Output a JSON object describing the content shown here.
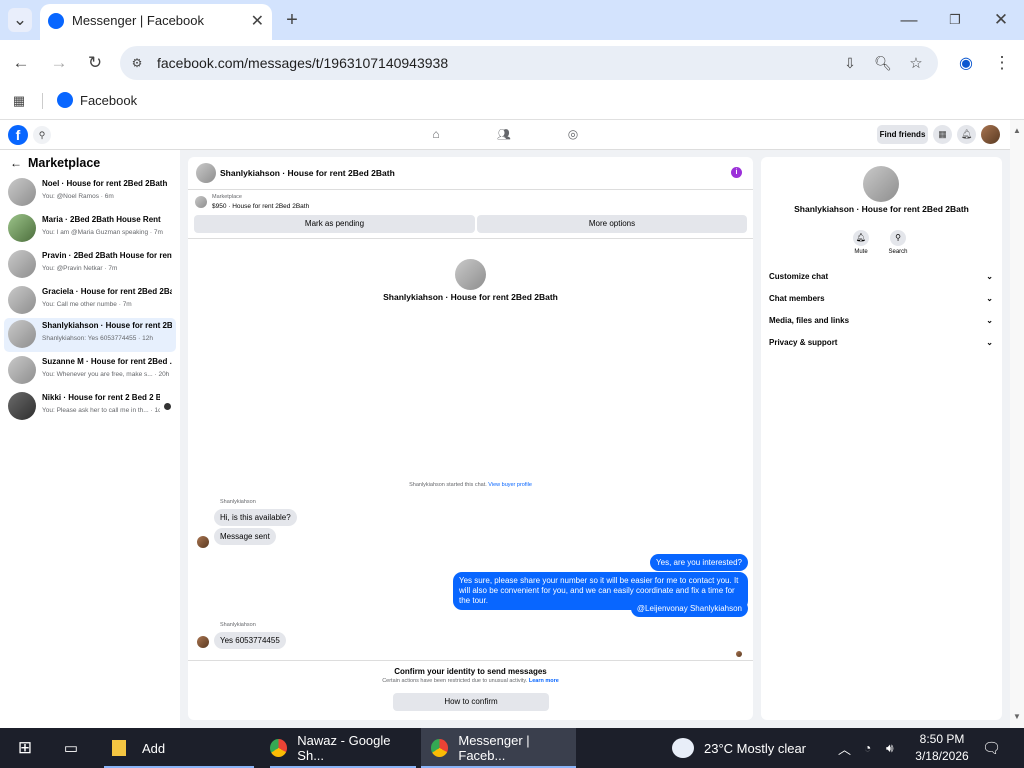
{
  "browser": {
    "tab_title": "Messenger | Facebook",
    "url": "facebook.com/messages/t/1963107140943938",
    "bookmark_label": "Facebook"
  },
  "fb_nav": {
    "find_friends": "Find friends"
  },
  "sidebar": {
    "title": "Marketplace",
    "conversations": [
      {
        "name": "Noel · House for rent 2Bed 2Bath",
        "preview": "You: @Noel Ramos · 6m"
      },
      {
        "name": "Maria · 2Bed 2Bath House Rent",
        "preview": "You: I am @Maria Guzman speaking · 7m"
      },
      {
        "name": "Pravin · 2Bed 2Bath House for rent",
        "preview": "You: @Pravin Netkar · 7m"
      },
      {
        "name": "Graciela · House for rent 2Bed 2Bath",
        "preview": "You: Call me other numbe · 7m"
      },
      {
        "name": "Shanlykiahson · House for rent 2B...",
        "preview": "Shanlykiahson: Yes 6053774455 · 12h"
      },
      {
        "name": "Suzanne M · House for rent 2Bed ...",
        "preview": "You: Whenever you are free, make s... · 20h"
      },
      {
        "name": "Nikki · House for rent 2 Bed 2 B...",
        "preview": "You: Please ask her to call me in th... · 1d"
      }
    ]
  },
  "chat": {
    "header_title": "Shanlykiahson · House for rent 2Bed 2Bath",
    "marketplace_label": "Marketplace",
    "listing": "$950 · House for rent 2Bed 2Bath",
    "mark_pending": "Mark as pending",
    "more_options": "More options",
    "intro_name": "Shanlykiahson · House for rent 2Bed 2Bath",
    "started_text": "Shanlykiahson started this chat.",
    "view_profile": "View buyer profile",
    "sender_label_1": "Shanlykiahson",
    "msg_in_1": "Hi, is this available?",
    "msg_in_2": "Message sent",
    "msg_out_1": "Yes, are you interested?",
    "msg_out_2": "Yes sure, please share your number so it will be easier for me to contact you. It will also be convenient for you, and we can easily coordinate and fix a time for the tour.",
    "msg_out_3": "@Leijenvonay Shanlykiahson",
    "sender_label_2": "Shanlykiahson",
    "msg_in_3": "Yes 6053774455",
    "confirm_title": "Confirm your identity to send messages",
    "confirm_sub": "Certain actions have been restricted due to unusual activity.",
    "learn_more": "Learn more",
    "how_to_confirm": "How to confirm"
  },
  "right_panel": {
    "name": "Shanlykiahson · House for rent 2Bed 2Bath",
    "mute": "Mute",
    "search": "Search",
    "rows": [
      "Customize chat",
      "Chat members",
      "Media, files and links",
      "Privacy & support"
    ]
  },
  "taskbar": {
    "add_label": "Add",
    "app1": "Nawaz - Google Sh...",
    "app2": "Messenger | Faceb...",
    "weather": "23°C  Mostly clear",
    "time": "8:50 PM",
    "date": "3/18/2026"
  },
  "colors": {
    "accent": "#0866ff",
    "tabbar_bg": "#d3e3fd",
    "taskbar_bg": "#1c1f2a"
  }
}
